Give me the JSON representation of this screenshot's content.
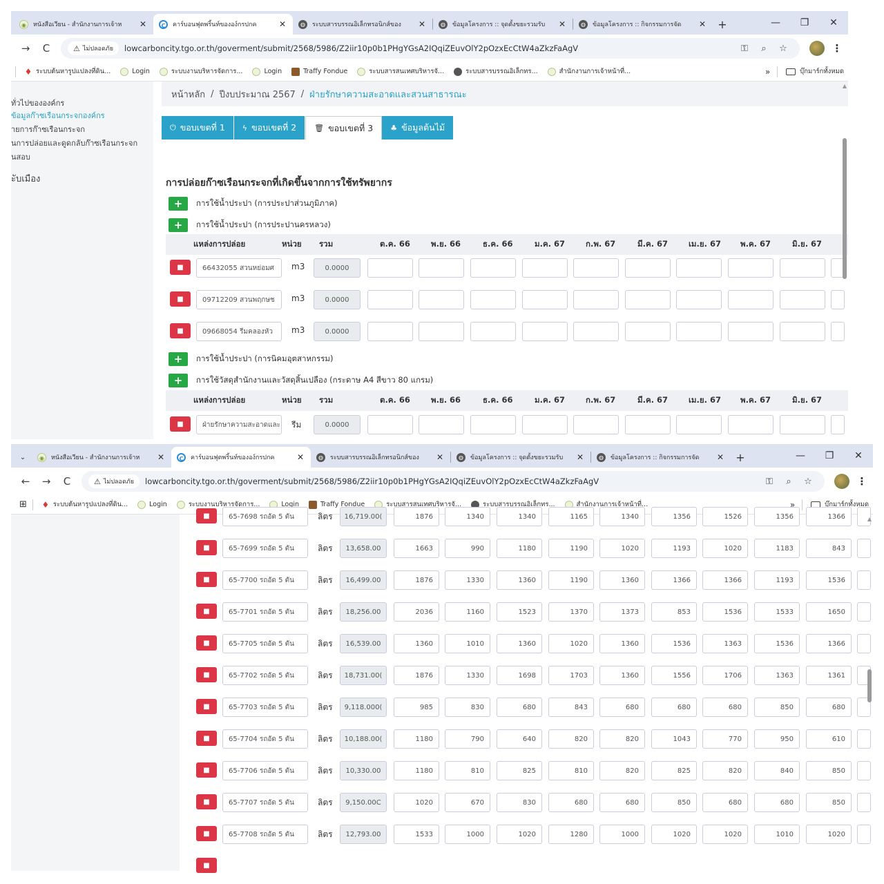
{
  "window1": {
    "tabs": [
      {
        "icon": "logo",
        "label": "หนังสือเวียน - สำนักงานการเจ้าห",
        "active": false
      },
      {
        "icon": "chrome",
        "label": "คาร์บอนฟุตพริ้นท์ขององ์กรปกค",
        "active": true
      },
      {
        "icon": "globe",
        "label": "ระบบสารบรรณอิเล็กทรอนิกส์ของ",
        "active": false
      },
      {
        "icon": "globe",
        "label": "ข้อมูลโครงการ :: จุดตั้งขยะรวมรับ",
        "active": false
      },
      {
        "icon": "globe",
        "label": "ข้อมูลโครงการ :: กิจกรรมการจัด",
        "active": false
      }
    ],
    "url": "lowcarboncity.tgo.or.th/goverment/submit/2568/5986/Z2iir10p0b1PHgYGsA2IQqiZEuvOlY2pOzxEcCtW4aZkzFaAgV",
    "secure_label": "ไม่ปลอดภัย",
    "sidebar": [
      {
        "label": "ทั่วไปขององค์กร",
        "active": false
      },
      {
        "label": "ข้อมูลก๊าซเรือนกระจกองค์กร",
        "active": true
      },
      {
        "label": "ายการก๊าซเรือนกระจก",
        "active": false
      },
      {
        "label": "นการปล่อยและดูดกลับก๊าซเรือนกระจก",
        "active": false
      },
      {
        "label": "นสอบ",
        "active": false
      },
      {
        "label": "ะับเมือง",
        "active": false
      }
    ],
    "breadcrumb": [
      "หน้าหลัก",
      "ปีงบประมาณ 2567",
      "ฝ่ายรักษาความสะอาดและสวนสาธารณะ"
    ],
    "scope_tabs": [
      {
        "label": "ขอบเขตที่ 1",
        "icon": "power-icon"
      },
      {
        "label": "ขอบเขตที่ 2",
        "icon": "bolt-icon"
      },
      {
        "label": "ขอบเขตที่ 3",
        "icon": "trash-icon"
      },
      {
        "label": "ข้อมูลต้นไม้",
        "icon": "tree-icon"
      }
    ],
    "section_title": "การปล่อยก๊าซเรือนกระจกที่เกิดขึ้นจากการใช้ทรัพยากร",
    "categories": [
      "การใช้น้ำประปา (การประปาส่วนภูมิภาค)",
      "การใช้น้ำประปา (การประปานครหลวง)",
      "การใช้น้ำประปา (การนิคมอุตสาหกรรม)",
      "การใช้วัสดุสำนักงานและวัสดุสิ้นเปลือง (กระดาษ A4 สีขาว 80 แกรม)"
    ],
    "columns": [
      "แหล่งการปล่อย",
      "หน่วย",
      "รวม",
      "ต.ค. 66",
      "พ.ย. 66",
      "ธ.ค. 66",
      "ม.ค. 67",
      "ก.พ. 67",
      "มี.ค. 67",
      "เม.ย. 67",
      "พ.ค. 67",
      "มิ.ย. 67"
    ],
    "water_rows": [
      {
        "source": "66432055 สวนหย่อมศ",
        "unit": "m3",
        "total": "0.0000"
      },
      {
        "source": "09712209 สวนพฤกษช",
        "unit": "m3",
        "total": "0.0000"
      },
      {
        "source": "09668054 รีมคลองหัว",
        "unit": "m3",
        "total": "0.0000"
      }
    ],
    "paper_rows": [
      {
        "source": "ฝ่ายรักษาความสะอาดและ",
        "unit": "รีม",
        "total": "0.0000"
      }
    ]
  },
  "window2": {
    "tabs": [
      {
        "icon": "logo",
        "label": "หนังสือเวียน - สำนักงานการเจ้าห",
        "active": false
      },
      {
        "icon": "chrome",
        "label": "คาร์บอนฟุตพริ้นท์ขององ์กรปกค",
        "active": true
      },
      {
        "icon": "globe",
        "label": "ระบบสารบรรณอิเล็กทรอนิกส์ของ",
        "active": false
      },
      {
        "icon": "globe",
        "label": "ข้อมูลโครงการ :: จุดตั้งขยะรวมรับ",
        "active": false
      },
      {
        "icon": "globe",
        "label": "ข้อมูลโครงการ :: กิจกรรมการจัด",
        "active": false
      }
    ],
    "url": "lowcarboncity.tgo.or.th/goverment/submit/2568/5986/Z2iir10p0b1PHgYGsA2IQqiZEuvOlY2pOzxEcCtW4aZkzFaAgV",
    "secure_label": "ไม่ปลอดภัย",
    "vehicle_rows": [
      {
        "source": "65-7698 รถอัด 5 ตัน",
        "unit": "ลิตร",
        "total": "16,719.00(",
        "months": [
          "1876",
          "1340",
          "1340",
          "1165",
          "1340",
          "1356",
          "1526",
          "1356",
          "1366"
        ]
      },
      {
        "source": "65-7699 รถอัด 5 ตัน",
        "unit": "ลิตร",
        "total": "13,658.00",
        "months": [
          "1663",
          "990",
          "1180",
          "1190",
          "1020",
          "1193",
          "1020",
          "1183",
          "843"
        ]
      },
      {
        "source": "65-7700 รถอัด 5 ตัน",
        "unit": "ลิตร",
        "total": "16,499.00",
        "months": [
          "1876",
          "1330",
          "1360",
          "1190",
          "1360",
          "1366",
          "1366",
          "1193",
          "1536"
        ]
      },
      {
        "source": "65-7701 รถอัด 5 ตัน",
        "unit": "ลิตร",
        "total": "18,256.00",
        "months": [
          "2036",
          "1160",
          "1523",
          "1370",
          "1373",
          "853",
          "1536",
          "1533",
          "1650"
        ]
      },
      {
        "source": "65-7705 รถอัด 5 ตัน",
        "unit": "ลิตร",
        "total": "16,539.00",
        "months": [
          "1360",
          "1010",
          "1360",
          "1020",
          "1360",
          "1536",
          "1363",
          "1536",
          "1366"
        ]
      },
      {
        "source": "65-7702 รถอัด 5 ตัน",
        "unit": "ลิตร",
        "total": "18,731.00(",
        "months": [
          "1876",
          "1330",
          "1698",
          "1703",
          "1360",
          "1556",
          "1706",
          "1363",
          "1361"
        ]
      },
      {
        "source": "65-7703 รถอัด 5 ตัน",
        "unit": "ลิตร",
        "total": "9,118.000(",
        "months": [
          "985",
          "830",
          "680",
          "843",
          "680",
          "680",
          "680",
          "850",
          "680"
        ]
      },
      {
        "source": "65-7704 รถอัด 5 ตัน",
        "unit": "ลิตร",
        "total": "10,188.00(",
        "months": [
          "1180",
          "790",
          "640",
          "820",
          "820",
          "1043",
          "770",
          "950",
          "610"
        ]
      },
      {
        "source": "65-7706 รถอัด 5 ตัน",
        "unit": "ลิตร",
        "total": "10,330.00",
        "months": [
          "1180",
          "810",
          "825",
          "810",
          "820",
          "825",
          "820",
          "840",
          "850"
        ]
      },
      {
        "source": "65-7707 รถอัด 5 ตัน",
        "unit": "ลิตร",
        "total": "9,150.00C",
        "months": [
          "1020",
          "670",
          "830",
          "680",
          "680",
          "850",
          "680",
          "680",
          "850"
        ]
      },
      {
        "source": "65-7708 รถอัด 5 ตัน",
        "unit": "ลิตร",
        "total": "12,793.00",
        "months": [
          "1533",
          "1000",
          "1020",
          "1280",
          "1000",
          "1020",
          "1020",
          "1010",
          "1020"
        ]
      }
    ]
  },
  "bookmarks": [
    "ระบบต้นหารูปแปลงที่ดิน...",
    "Login",
    "ระบบงานบริหารจัดการ...",
    "Login",
    "Traffy Fondue",
    "ระบบสารสนเทศบริหารจั...",
    "ระบบสารบรรณอิเล็กทร...",
    "สำนักงานการเจ้าหน้าที่..."
  ],
  "all_bookmarks_label": "บุ๊กมาร์กทั้งหมด",
  "colors": {
    "accent": "#2aa2c9",
    "add": "#28a745",
    "delete": "#dc3545"
  }
}
